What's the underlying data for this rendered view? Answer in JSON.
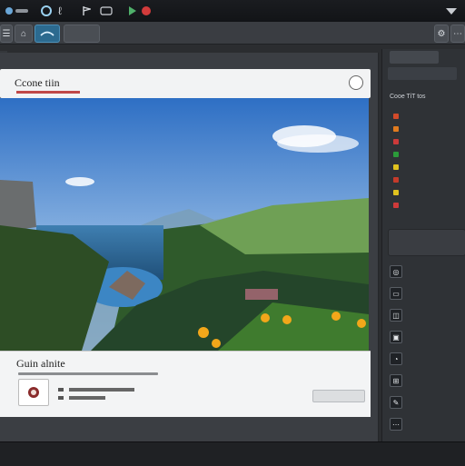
{
  "titlebar": {
    "app_title": "",
    "tab_label": "",
    "right_label": ""
  },
  "toolbar": {
    "search_placeholder": ""
  },
  "header": {
    "title": "Ccone tiin"
  },
  "caption": {
    "title": "Guin alnite",
    "button_label": ""
  },
  "sidebar": {
    "top_tab": "",
    "section_label": "Cooe TiT tos",
    "layers": [
      {
        "label": "",
        "color": "#d24a2a"
      },
      {
        "label": "",
        "color": "#e07b1f"
      },
      {
        "label": "",
        "color": "#cc3a3a"
      },
      {
        "label": "",
        "color": "#2b9b3a"
      },
      {
        "label": "",
        "color": "#e0c21f"
      },
      {
        "label": "",
        "color": "#c43b2b"
      },
      {
        "label": "",
        "color": "#e0c21f"
      },
      {
        "label": "",
        "color": "#cf3a3a"
      }
    ],
    "tools": [
      {
        "label": ""
      },
      {
        "label": ""
      },
      {
        "label": ""
      },
      {
        "label": ""
      },
      {
        "label": ""
      },
      {
        "label": ""
      },
      {
        "label": ""
      },
      {
        "label": ""
      }
    ]
  },
  "colors": {
    "accent": "#c04848",
    "panel": "#3b3e43",
    "card": "#f2f3f4"
  }
}
